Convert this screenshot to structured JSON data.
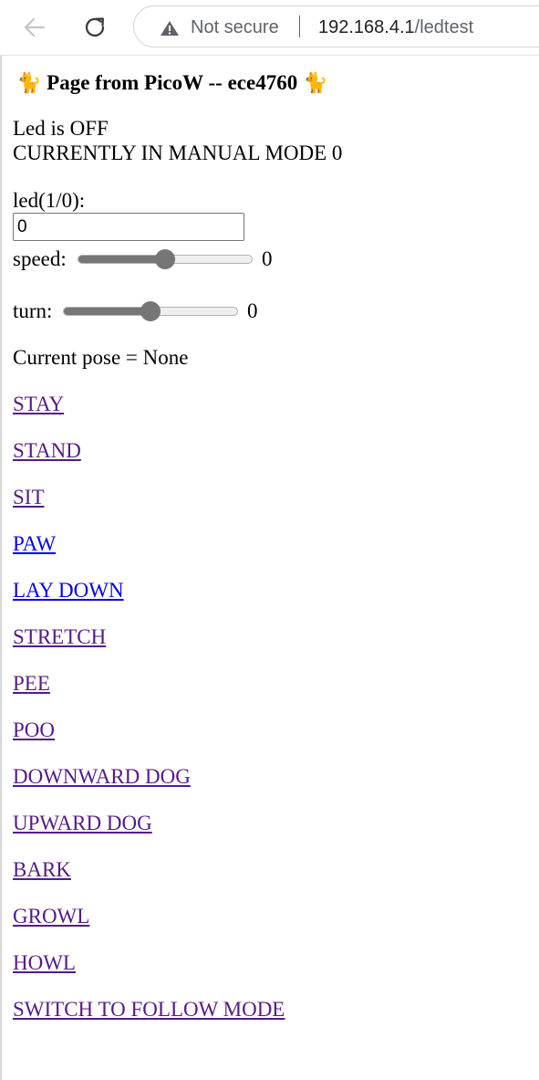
{
  "browser": {
    "security_label": "Not secure",
    "url_host": "192.168.4.1",
    "url_path": "/ledtest"
  },
  "page": {
    "title_emoji": "🐈",
    "title": "Page from PicoW -- ece4760",
    "led_status": "Led is OFF",
    "mode_status": "CURRENTLY IN MANUAL MODE 0",
    "led_label": "led(1/0):",
    "led_value": "0",
    "speed_label": "speed:",
    "speed_value": "0",
    "speed_fraction": 0.5,
    "turn_label": "turn:",
    "turn_value": "0",
    "turn_fraction": 0.5,
    "pose_text": "Current pose = None",
    "links": [
      {
        "label": "STAY",
        "visited": true
      },
      {
        "label": "STAND",
        "visited": true
      },
      {
        "label": "SIT",
        "visited": true
      },
      {
        "label": "PAW",
        "visited": false
      },
      {
        "label": "LAY DOWN",
        "visited": false
      },
      {
        "label": "STRETCH",
        "visited": true
      },
      {
        "label": "PEE",
        "visited": true
      },
      {
        "label": "POO",
        "visited": true
      },
      {
        "label": "DOWNWARD DOG",
        "visited": true
      },
      {
        "label": "UPWARD DOG",
        "visited": true
      },
      {
        "label": "BARK",
        "visited": true
      },
      {
        "label": "GROWL",
        "visited": true
      },
      {
        "label": "HOWL",
        "visited": true
      },
      {
        "label": "SWITCH TO FOLLOW MODE",
        "visited": true
      }
    ]
  },
  "colors": {
    "visited_link": "#551a8b",
    "unvisited_link": "#0000ee",
    "slider": "#767676"
  }
}
